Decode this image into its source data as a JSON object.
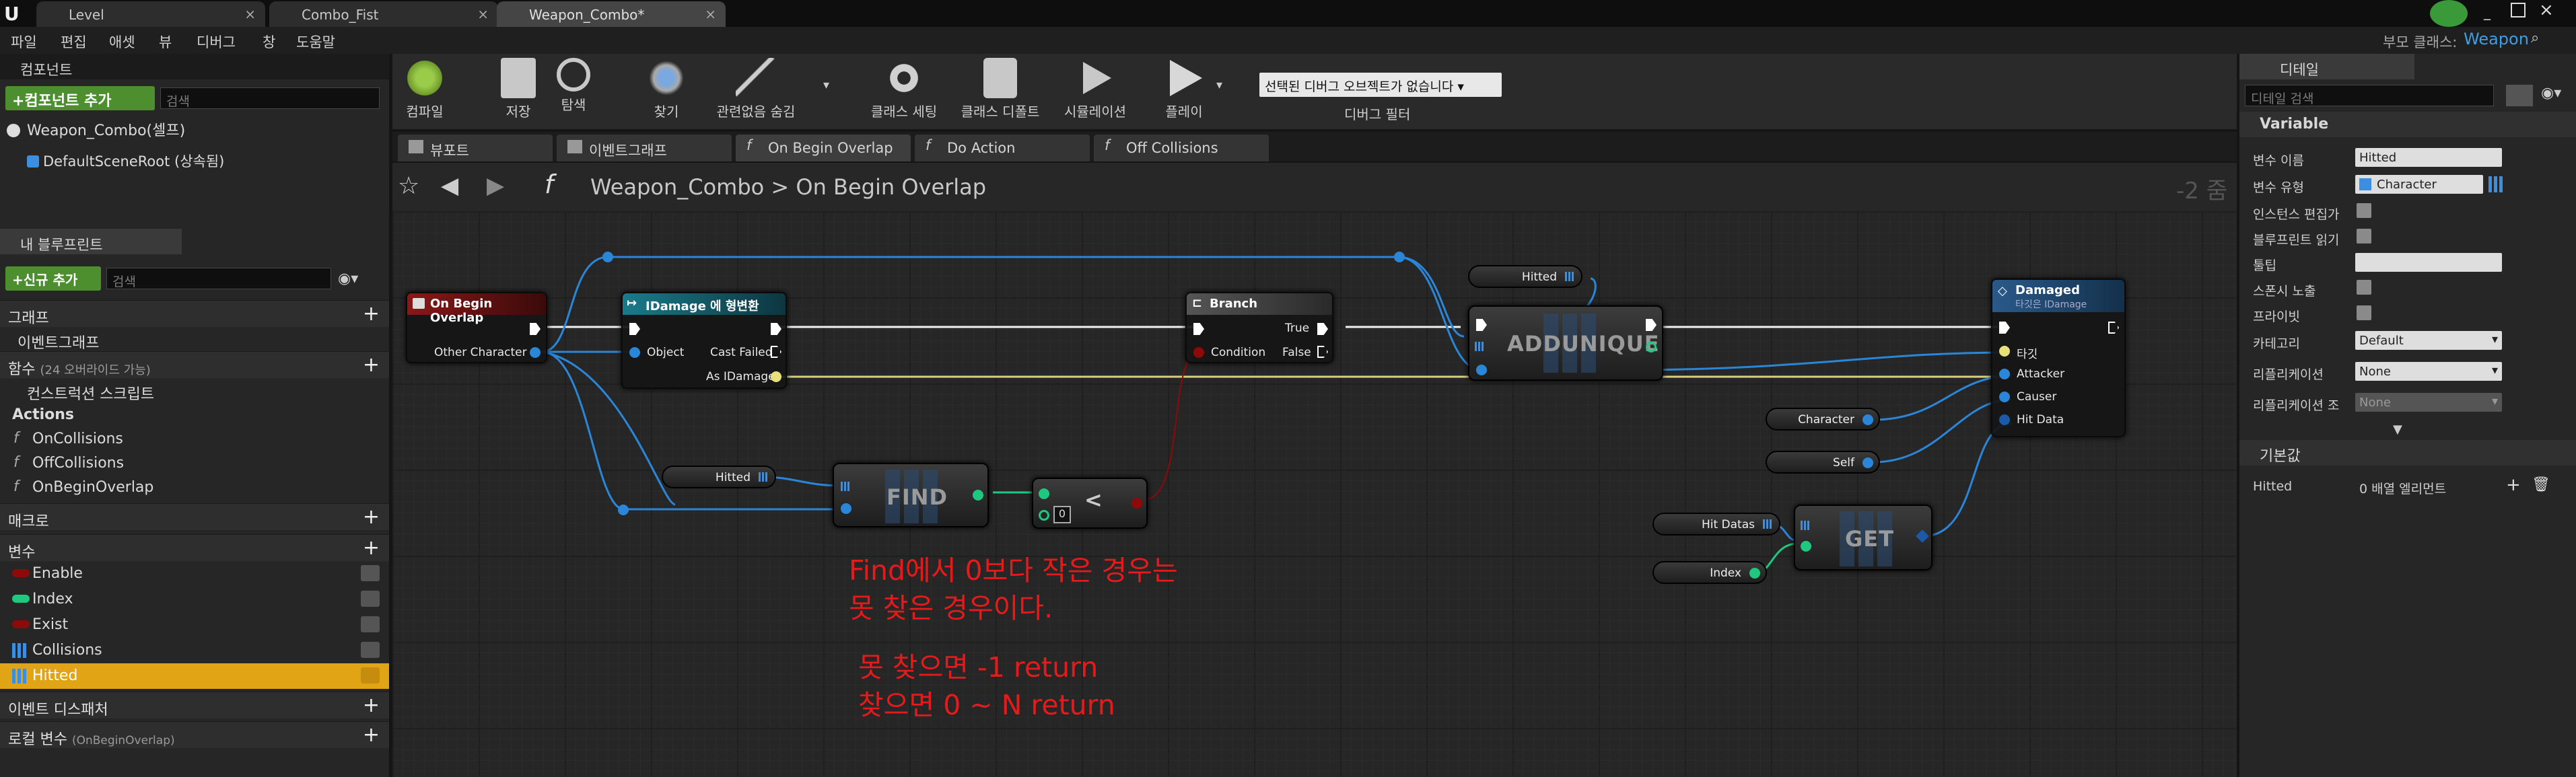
{
  "tabs": [
    {
      "label": "Level"
    },
    {
      "label": "Combo_Fist"
    },
    {
      "label": "Weapon_Combo*"
    }
  ],
  "parent_class": {
    "label": "부모 클래스:",
    "value": "Weapon"
  },
  "menu": [
    "파일",
    "편집",
    "애셋",
    "뷰",
    "디버그",
    "창",
    "도움말"
  ],
  "components": {
    "title": "컴포넌트",
    "add_label": "+컴포넌트 추가",
    "search_placeholder": "검색",
    "self_item": "Weapon_Combo(셀프)",
    "root_item": "DefaultSceneRoot (상속됨)"
  },
  "my_blueprint": {
    "title": "내 블루프린트",
    "new_label": "+신규 추가",
    "search_placeholder": "검색",
    "graph_cat": "그래프",
    "event_graph": "이벤트그래프",
    "functions_cat": "함수",
    "functions_overridable": "(24 오버라이드 가능)",
    "construction": "컨스트럭션 스크립트",
    "actions_cat": "Actions",
    "actions": [
      "OnCollisions",
      "OffCollisions",
      "OnBeginOverlap"
    ],
    "macros_cat": "매크로",
    "variables_cat": "변수",
    "variables": [
      {
        "name": "Enable",
        "color": "#8e0a0a"
      },
      {
        "name": "Index",
        "color": "#1ec97f"
      },
      {
        "name": "Exist",
        "color": "#8e0a0a"
      },
      {
        "name": "Collisions",
        "color": "#3b8ee0"
      },
      {
        "name": "Hitted",
        "color": "#3b8ee0"
      }
    ],
    "dispatchers_cat": "이벤트 디스패처",
    "locals_cat": "로컬 변수",
    "locals_sub": "(OnBeginOverlap)"
  },
  "toolbar": {
    "compile": "컴파일",
    "save": "저장",
    "browse": "탐색",
    "find": "찾기",
    "hide_unrelated": "관련없음 숨김",
    "class_settings": "클래스 세팅",
    "class_defaults": "클래스 디폴트",
    "simulation": "시뮬레이션",
    "play": "플레이",
    "debug_object": "선택된 디버그 오브젝트가 없습니다",
    "debug_filter": "디버그 필터"
  },
  "graph_tabs": [
    "뷰포트",
    "이벤트그래프",
    "On Begin Overlap",
    "Do Action",
    "Off Collisions"
  ],
  "breadcrumb": {
    "root": "Weapon_Combo",
    "sep": ">",
    "current": "On Begin Overlap",
    "zoom": "-2 줌"
  },
  "nodes": {
    "event": {
      "title": "On Begin Overlap",
      "pin": "Other Character"
    },
    "cast": {
      "title": "IDamage 에 형변환",
      "object": "Object",
      "cast_failed": "Cast Failed",
      "as_idamage": "As IDamage"
    },
    "branch": {
      "title": "Branch",
      "condition": "Condition",
      "true": "True",
      "false": "False"
    },
    "hitted_top": "Hitted",
    "addunique": "ADDUNIQUE",
    "damaged": {
      "title": "Damaged",
      "subtitle": "타깃은 IDamage",
      "target": "타깃",
      "attacker": "Attacker",
      "causer": "Causer",
      "hitdata": "Hit Data"
    },
    "character": "Character",
    "self": "Self",
    "hitted_find": "Hitted",
    "find": "FIND",
    "less": "<",
    "zero": "0",
    "hitdatas": "Hit Datas",
    "index": "Index",
    "get": "GET"
  },
  "notes": [
    "Find에서 0보다 작은 경우는",
    "못 찾은 경우이다.",
    "못 찾으면 -1 return",
    "찾으면 0 ~ N return"
  ],
  "details": {
    "title": "디테일",
    "search_placeholder": "디테일 검색",
    "variable_cat": "Variable",
    "var_name_label": "변수 이름",
    "var_name": "Hitted",
    "var_type_label": "변수 유형",
    "var_type": "Character",
    "instance_editable": "인스턴스 편집가",
    "bp_readonly": "블루프린트 읽기",
    "tooltip": "툴팁",
    "expose_spawn": "스폰시 노출",
    "private": "프라이빗",
    "category_label": "카테고리",
    "category": "Default",
    "replication_label": "리플리케이션",
    "replication": "None",
    "rep_condition_label": "리플리케이션 조",
    "rep_condition": "None",
    "defaults_cat": "기본값",
    "default_name": "Hitted",
    "default_value": "0 배열 엘리먼트"
  }
}
